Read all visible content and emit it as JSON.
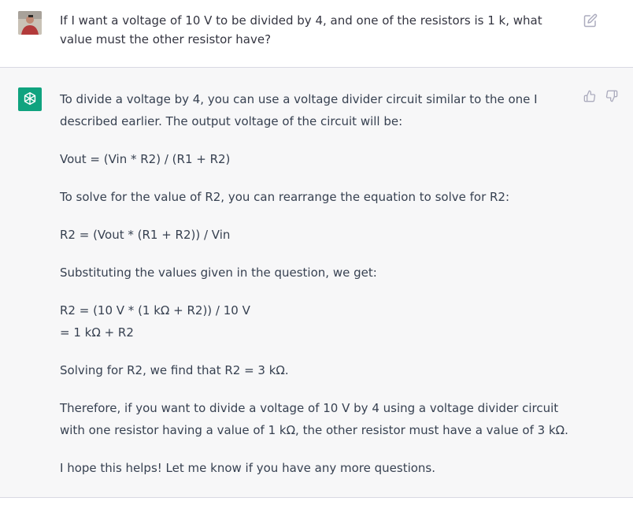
{
  "user_message": {
    "text": "If I want a voltage of 10 V to be divided by 4, and one of the resistors is 1 k, what value must the other resistor have?",
    "edit_icon": "edit-icon"
  },
  "assistant_message": {
    "paragraphs": [
      "To divide a voltage by 4, you can use a voltage divider circuit similar to the one I described earlier. The output voltage of the circuit will be:",
      "Vout = (Vin * R2) / (R1 + R2)",
      "To solve for the value of R2, you can rearrange the equation to solve for R2:",
      "R2 = (Vout * (R1 + R2)) / Vin",
      "Substituting the values given in the question, we get:",
      "R2 = (10 V * (1 kΩ + R2)) / 10 V",
      "= 1 kΩ + R2",
      "Solving for R2, we find that R2 = 3 kΩ.",
      "Therefore, if you want to divide a voltage of 10 V by 4 using a voltage divider circuit with one resistor having a value of 1 kΩ, the other resistor must have a value of 3 kΩ.",
      "I hope this helps! Let me know if you have any more questions."
    ],
    "feedback_icons": [
      "thumbs-up-icon",
      "thumbs-down-icon"
    ]
  },
  "colors": {
    "assistant_bg": "#f7f7f8",
    "brand": "#10a37f",
    "text": "#374151",
    "icon": "#acacbe"
  }
}
